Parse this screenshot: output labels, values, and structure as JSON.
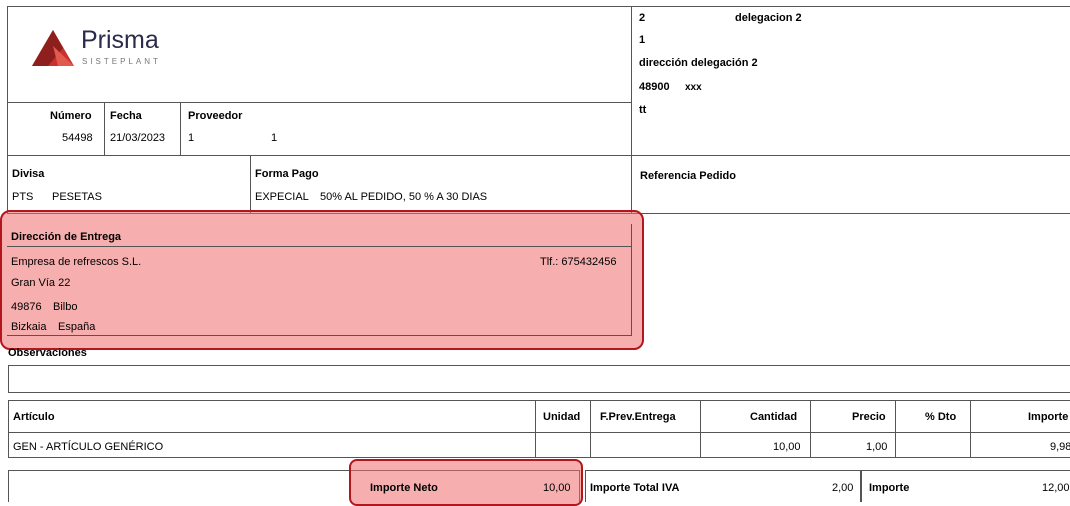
{
  "logo": {
    "name": "Prisma",
    "sub": "SISTEPLANT"
  },
  "order": {
    "numero_label": "Número",
    "numero": "54498",
    "fecha_label": "Fecha",
    "fecha": "21/03/2023",
    "proveedor_label": "Proveedor",
    "proveedor_code": "1",
    "proveedor_name": "1"
  },
  "delegation": {
    "line1_code": "2",
    "line1_name": "delegacion 2",
    "line2": "1",
    "line3": "dirección delegación 2",
    "line4_cp": "48900",
    "line4_city": "xxx",
    "line5": "tt"
  },
  "divisa": {
    "label": "Divisa",
    "code": "PTS",
    "name": "PESETAS"
  },
  "forma_pago": {
    "label": "Forma Pago",
    "code": "EXPECIAL",
    "desc": "50% AL PEDIDO, 50 % A 30 DIAS"
  },
  "referencia": {
    "label": "Referencia Pedido"
  },
  "entrega": {
    "label": "Dirección de Entrega",
    "company": "Empresa de refrescos S.L.",
    "phone": "Tlf.: 675432456",
    "street": "Gran Vía 22",
    "cp": "49876",
    "city": "Bilbo",
    "province": "Bizkaia",
    "country": "España"
  },
  "observaciones": {
    "label": "Observaciones"
  },
  "table": {
    "headers": {
      "articulo": "Artículo",
      "unidad": "Unidad",
      "fprev": "F.Prev.Entrega",
      "cantidad": "Cantidad",
      "precio": "Precio",
      "dto": "% Dto",
      "importe": "Importe"
    },
    "row": {
      "articulo": "GEN - ARTÍCULO GENÉRICO",
      "cantidad": "10,00",
      "precio": "1,00",
      "importe": "9,98"
    }
  },
  "totals": {
    "neto_label": "Importe Neto",
    "neto": "10,00",
    "iva_label": "Importe Total IVA",
    "iva": "2,00",
    "importe_label": "Importe",
    "importe": "12,00"
  },
  "colors": {
    "highlight": "#ef6b6b",
    "highlight_border": "#b3161c",
    "logo_red": "#c8312c"
  }
}
